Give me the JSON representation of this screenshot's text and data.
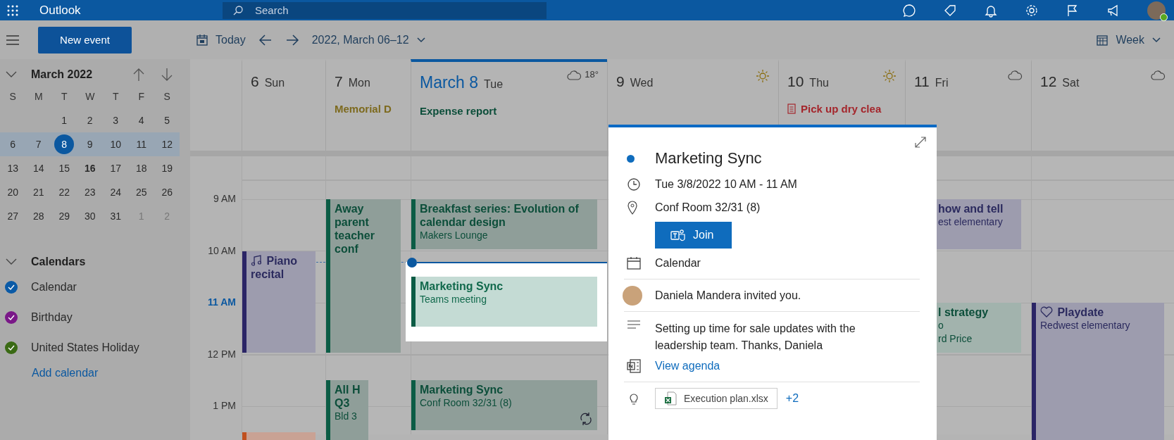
{
  "top_bar": {
    "app_name": "Outlook",
    "search": {
      "placeholder": "Search"
    }
  },
  "toolbar": {
    "new_event": "New event",
    "today": "Today",
    "range": "2022, March 06–12",
    "view": "Week"
  },
  "mini_calendar": {
    "title": "March 2022",
    "expanded": true,
    "weekdays": [
      "S",
      "M",
      "T",
      "W",
      "T",
      "F",
      "S"
    ],
    "weeks": [
      {
        "selected": false,
        "days": [
          {
            "label": "1",
            "selected": false,
            "bold": false,
            "muted": false
          },
          {
            "label": "2",
            "selected": false,
            "bold": false,
            "muted": false
          },
          {
            "label": "3",
            "selected": false,
            "bold": false,
            "muted": false
          },
          {
            "label": "4",
            "selected": false,
            "bold": false,
            "muted": false
          },
          {
            "label": "5",
            "selected": false,
            "bold": false,
            "muted": false
          }
        ]
      },
      {
        "selected": true,
        "days": [
          {
            "label": "6",
            "selected": false,
            "bold": false,
            "muted": false
          },
          {
            "label": "7",
            "selected": false,
            "bold": false,
            "muted": false
          },
          {
            "label": "8",
            "selected": true,
            "bold": false,
            "muted": false
          },
          {
            "label": "9",
            "selected": false,
            "bold": false,
            "muted": false
          },
          {
            "label": "10",
            "selected": false,
            "bold": false,
            "muted": false
          },
          {
            "label": "11",
            "selected": false,
            "bold": false,
            "muted": false
          },
          {
            "label": "12",
            "selected": false,
            "bold": false,
            "muted": false
          }
        ]
      },
      {
        "selected": false,
        "days": [
          {
            "label": "13",
            "selected": false,
            "bold": false,
            "muted": false
          },
          {
            "label": "14",
            "selected": false,
            "bold": false,
            "muted": false
          },
          {
            "label": "15",
            "selected": false,
            "bold": false,
            "muted": false
          },
          {
            "label": "16",
            "selected": false,
            "bold": true,
            "muted": false
          },
          {
            "label": "17",
            "selected": false,
            "bold": false,
            "muted": false
          },
          {
            "label": "18",
            "selected": false,
            "bold": false,
            "muted": false
          },
          {
            "label": "19",
            "selected": false,
            "bold": false,
            "muted": false
          }
        ]
      },
      {
        "selected": false,
        "days": [
          {
            "label": "20",
            "selected": false,
            "bold": false,
            "muted": false
          },
          {
            "label": "21",
            "selected": false,
            "bold": false,
            "muted": false
          },
          {
            "label": "22",
            "selected": false,
            "bold": false,
            "muted": false
          },
          {
            "label": "23",
            "selected": false,
            "bold": false,
            "muted": false
          },
          {
            "label": "24",
            "selected": false,
            "bold": false,
            "muted": false
          },
          {
            "label": "25",
            "selected": false,
            "bold": false,
            "muted": false
          },
          {
            "label": "26",
            "selected": false,
            "bold": false,
            "muted": false
          }
        ]
      },
      {
        "selected": false,
        "days": [
          {
            "label": "27",
            "selected": false,
            "bold": false,
            "muted": false
          },
          {
            "label": "28",
            "selected": false,
            "bold": false,
            "muted": false
          },
          {
            "label": "29",
            "selected": false,
            "bold": false,
            "muted": false
          },
          {
            "label": "30",
            "selected": false,
            "bold": false,
            "muted": false
          },
          {
            "label": "31",
            "selected": false,
            "bold": false,
            "muted": false
          },
          {
            "label": "1",
            "selected": false,
            "bold": false,
            "muted": true
          },
          {
            "label": "2",
            "selected": false,
            "bold": false,
            "muted": true
          }
        ]
      }
    ]
  },
  "calendars": {
    "title": "Calendars",
    "expanded": true,
    "items": [
      {
        "label": "Calendar",
        "checked": true,
        "color": "#0a5aa6"
      },
      {
        "label": "Birthday",
        "checked": true,
        "color": "#7a1888"
      },
      {
        "label": "United States Holiday",
        "checked": true,
        "color": "#3a6a14"
      }
    ],
    "add_link": "Add calendar"
  },
  "time_labels": [
    {
      "label": "9 AM",
      "current": false
    },
    {
      "label": "10 AM",
      "current": false
    },
    {
      "label": "11 AM",
      "current": true
    },
    {
      "label": "12 PM",
      "current": false
    },
    {
      "label": "1 PM",
      "current": false
    }
  ],
  "days": [
    {
      "number": "6",
      "name": "Sun",
      "today": false,
      "events": [
        {
          "kind": "music",
          "title": "Piano recital",
          "selected": false
        },
        {
          "kind": "family",
          "selected": false
        }
      ]
    },
    {
      "number": "7",
      "name": "Mon",
      "today": false,
      "all_day": {
        "kind": "holiday",
        "title": "Memorial D"
      },
      "events": [
        {
          "kind": "work",
          "title": "Away parent teacher conf",
          "selected": false
        },
        {
          "kind": "work",
          "title": "All H Q3",
          "details": [
            "Bld 3"
          ],
          "narrow": true,
          "selected": false
        }
      ]
    },
    {
      "number": "March 8",
      "name": "Tue",
      "today": true,
      "weather": {
        "kind": "cloud",
        "temperature": "18°"
      },
      "all_day": {
        "kind": "event",
        "title": "Expense report"
      },
      "events": [
        {
          "kind": "work",
          "title": "Breakfast series: Evolution of calendar design",
          "details": [
            "Makers Lounge"
          ],
          "selected": false
        },
        {
          "kind": "work",
          "title": "Marketing Sync",
          "details": [
            "Teams meeting"
          ],
          "selected": true
        },
        {
          "kind": "recurring",
          "title": "Marketing Sync",
          "details": [
            "Conf Room 32/31 (8)"
          ],
          "selected": false
        }
      ]
    },
    {
      "number": "9",
      "name": "Wed",
      "today": false,
      "weather": {
        "kind": "sun"
      }
    },
    {
      "number": "10",
      "name": "Thu",
      "today": false,
      "weather": {
        "kind": "sun"
      },
      "all_day": {
        "kind": "task",
        "title": "Pick up dry clea"
      }
    },
    {
      "number": "11",
      "name": "Fri",
      "today": false,
      "weather": {
        "kind": "cloud"
      },
      "events": [
        {
          "kind": "personal",
          "title": "how and tell",
          "details": [
            "est elementary"
          ],
          "covered": true,
          "selected": false
        },
        {
          "kind": "work",
          "title": "l strategy",
          "details": [
            "o",
            "rd Price"
          ],
          "covered": true,
          "selected": false
        }
      ]
    },
    {
      "number": "12",
      "name": "Sat",
      "today": false,
      "weather": {
        "kind": "cloud"
      },
      "events": [
        {
          "kind": "social",
          "title": "Playdate",
          "details": [
            "Redwest elementary"
          ],
          "selected": false
        }
      ]
    }
  ],
  "popup": {
    "title": "Marketing Sync",
    "color": "#0f6cbd",
    "time": "Tue 3/8/2022 10 AM - 11 AM",
    "location": "Conf Room 32/31 (8)",
    "join": "Join",
    "calendar": "Calendar",
    "organizer": "Daniela Mandera invited you.",
    "description": "Setting up time for sale updates with the leadership team. Thanks, Daniela",
    "agenda_link": "View agenda",
    "attachment": {
      "name": "Execution plan.xlsx",
      "more": "+2"
    }
  }
}
